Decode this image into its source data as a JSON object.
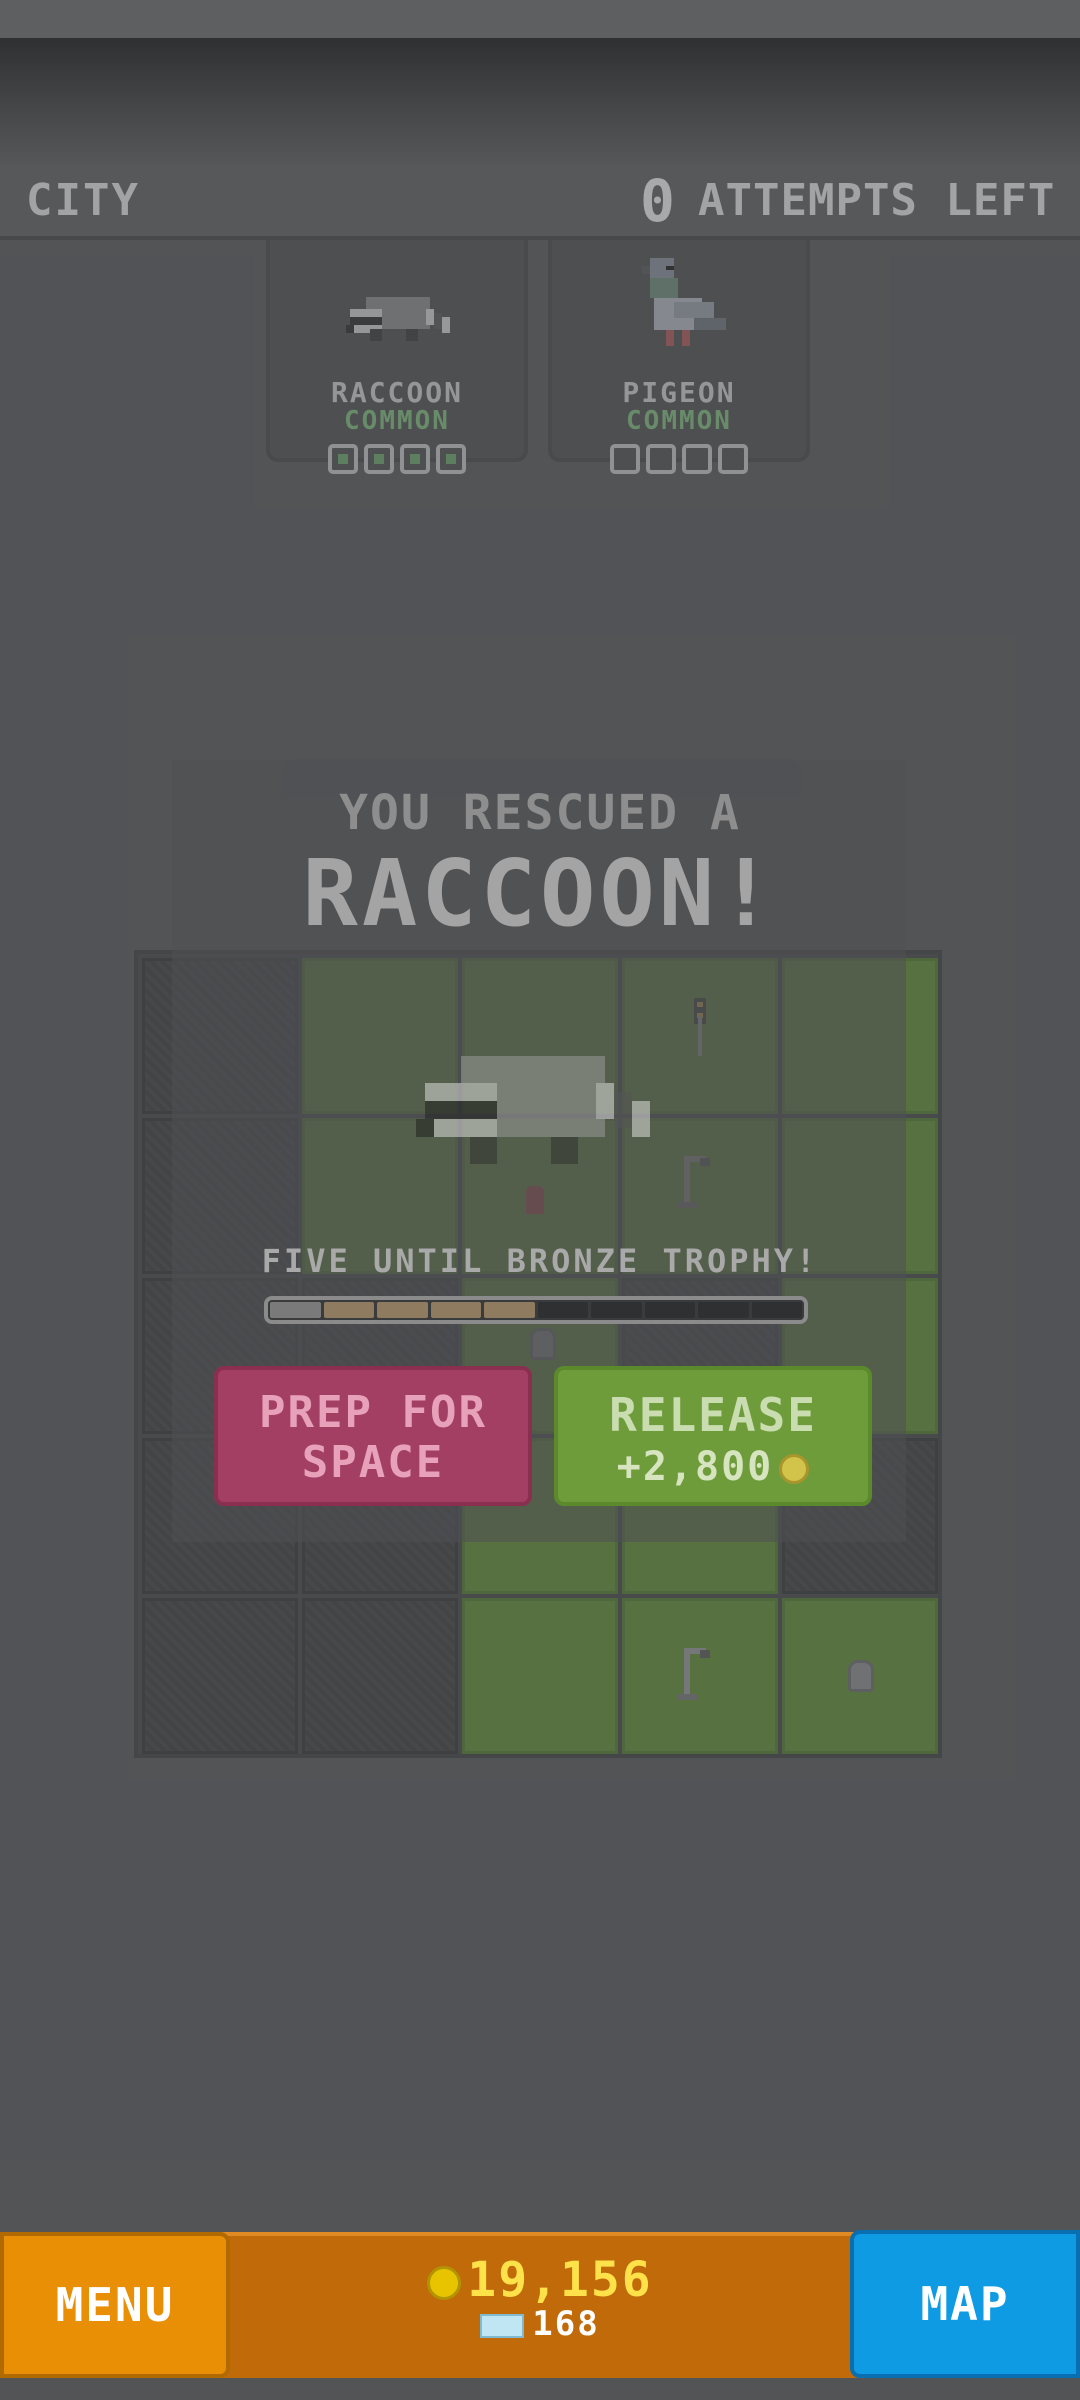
{
  "header": {
    "region": "CITY",
    "attempts_count": "0",
    "attempts_label": "ATTEMPTS LEFT"
  },
  "species_cards": [
    {
      "name": "RACCOON",
      "rarity": "COMMON",
      "progress": 4,
      "progress_max": 4,
      "icon": "raccoon-icon"
    },
    {
      "name": "PIGEON",
      "rarity": "COMMON",
      "progress": 0,
      "progress_max": 4,
      "icon": "pigeon-icon"
    }
  ],
  "dialog": {
    "headline": "YOU RESCUED A",
    "animal": "RACCOON!",
    "trophy_message": "FIVE UNTIL BRONZE TROPHY!",
    "trophy_progress": 5,
    "trophy_total": 10,
    "prep_button": "PREP FOR SPACE",
    "release_button": "RELEASE",
    "release_reward": "+2,800"
  },
  "bottom_bar": {
    "menu": "MENU",
    "map": "MAP",
    "coins": "19,156",
    "gems": "168"
  },
  "colors": {
    "grass": "#5d8f2b",
    "prep": "#a43f64",
    "release": "#6f9c3a",
    "menu": "#e98f05",
    "map": "#0e9be4",
    "coins": "#ffe24a"
  }
}
